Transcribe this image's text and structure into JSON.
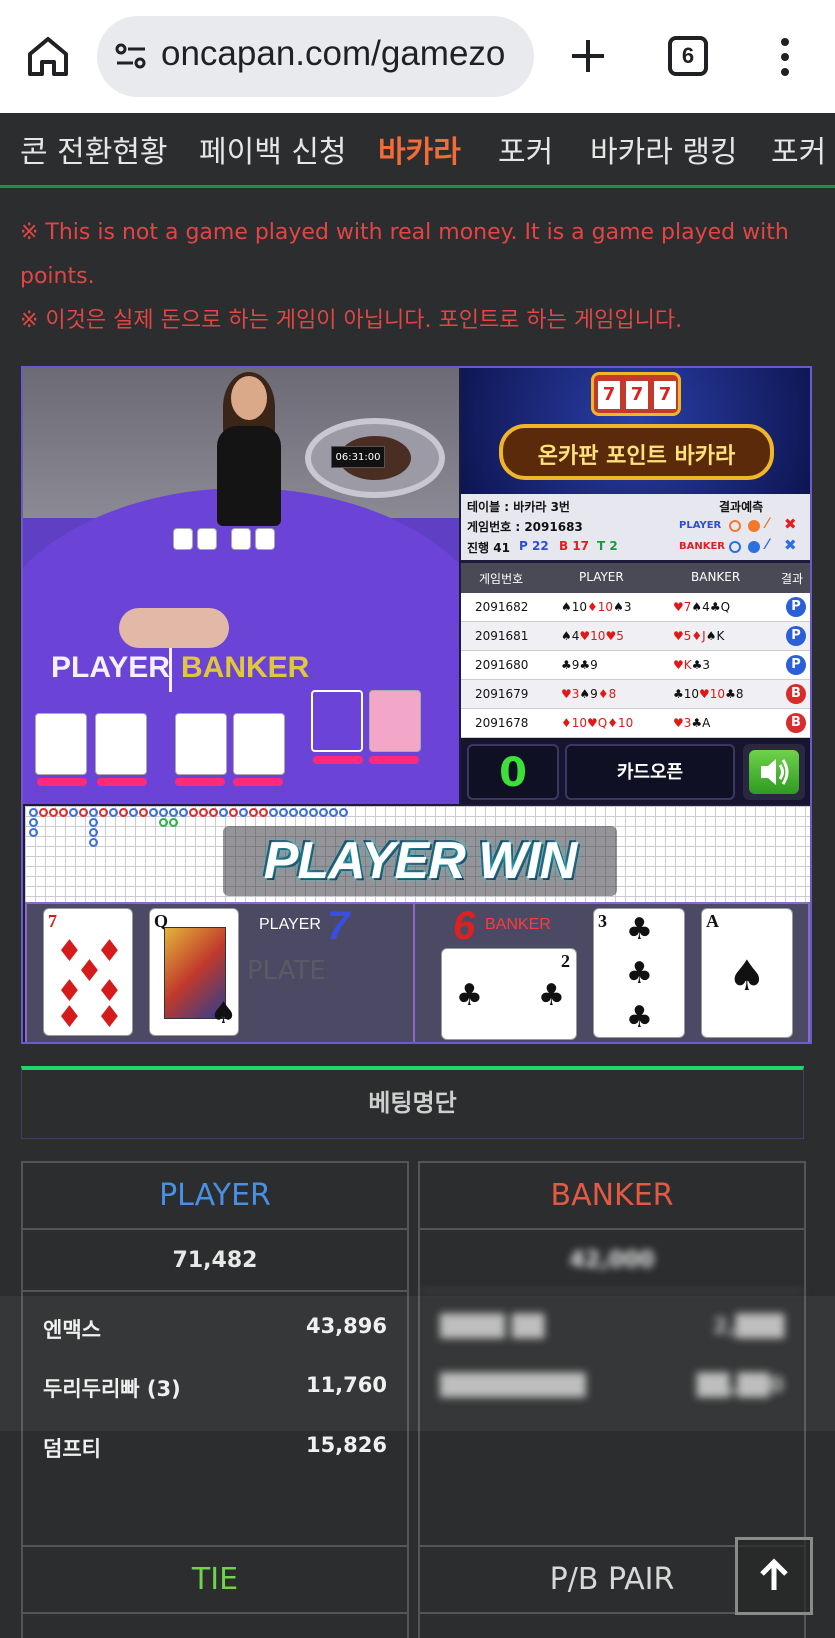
{
  "browser": {
    "url": "oncapan.com/gamezo",
    "tab_count": "6"
  },
  "nav": {
    "items": [
      "콘 전환현황",
      "페이백 신청",
      "바카라",
      "포커",
      "바카라 랭킹",
      "포커"
    ],
    "active_index": 2
  },
  "notice": {
    "en": "※ This is not a game played with real money. It is a game played with points.",
    "ko": "※ 이것은 실제 돈으로 하는 게임이 아닙니다. 포인트로 하는 게임입니다."
  },
  "game": {
    "logo_text": "온카판 포인트 바카라",
    "slot_reels": [
      "7",
      "7",
      "7"
    ],
    "table_label": "테이블 : 바카라 3번",
    "round_label": "게임번호 : 2091683",
    "predict_label": "결과예측",
    "progress_label": "진행 41",
    "p_count": "P 22",
    "b_count": "B 17",
    "t_count": "T 2",
    "pred_player": "PLAYER",
    "pred_banker": "BANKER",
    "video_player_label": "PLAYER",
    "video_banker_label": "BANKER",
    "clock_text": "06:31:00",
    "history_headers": [
      "게임번호",
      "PLAYER",
      "BANKER",
      "결과"
    ],
    "history": [
      {
        "round": "2091682",
        "player": "♠10♦10♠3",
        "banker": "♥7♠4♣Q",
        "result": "P"
      },
      {
        "round": "2091681",
        "player": "♠4♥10♥5",
        "banker": "♥5♦J♠K",
        "result": "P"
      },
      {
        "round": "2091680",
        "player": "♣9♣9",
        "banker": "♥K♣3",
        "result": "P"
      },
      {
        "round": "2091679",
        "player": "♥3♠9♦8",
        "banker": "♣10♥10♣8",
        "result": "B"
      },
      {
        "round": "2091678",
        "player": "♦10♥Q♦10",
        "banker": "♥3♣A",
        "result": "B"
      }
    ],
    "count_value": "0",
    "open_button": "카드오픈",
    "win_text": "PLAYER WIN",
    "player_score_label": "PLAYER",
    "player_score": "7",
    "banker_score_label": "BANKER",
    "banker_score": "6",
    "plate_text": "PLATE",
    "player_cards": [
      {
        "rank": "7",
        "suit": "♦",
        "color": "#d41c1c"
      },
      {
        "rank": "Q",
        "suit": "♠",
        "color": "#111111"
      }
    ],
    "banker_cards": [
      {
        "rank": "2",
        "suit": "♣",
        "color": "#111111"
      },
      {
        "rank": "3",
        "suit": "♣",
        "color": "#111111"
      },
      {
        "rank": "A",
        "suit": "♠",
        "color": "#111111"
      }
    ]
  },
  "betting": {
    "title": "베팅명단",
    "player": {
      "label": "PLAYER",
      "color": "#4a90e2",
      "total": "71,482",
      "rows": [
        {
          "name": "엔맥스",
          "amount": "43,896"
        },
        {
          "name": "두리두리빠 (3)",
          "amount": "11,760"
        },
        {
          "name": "덤프티",
          "amount": "15,826"
        }
      ]
    },
    "banker": {
      "label": "BANKER",
      "color": "#e05a44",
      "total": "42,000",
      "rows": [
        {
          "name": "████ ██",
          "amount": "2,███"
        },
        {
          "name": "█████████",
          "amount": "██,██0"
        }
      ]
    },
    "tie_label": "TIE",
    "tie_color": "#6fd44a",
    "pair_label": "P/B PAIR"
  },
  "icons": {
    "home": "home-icon",
    "site_settings": "site-settings-icon",
    "new_tab": "plus-icon",
    "overflow": "more-vert-icon",
    "sound": "speaker-icon",
    "scroll_top": "arrow-up-icon"
  }
}
